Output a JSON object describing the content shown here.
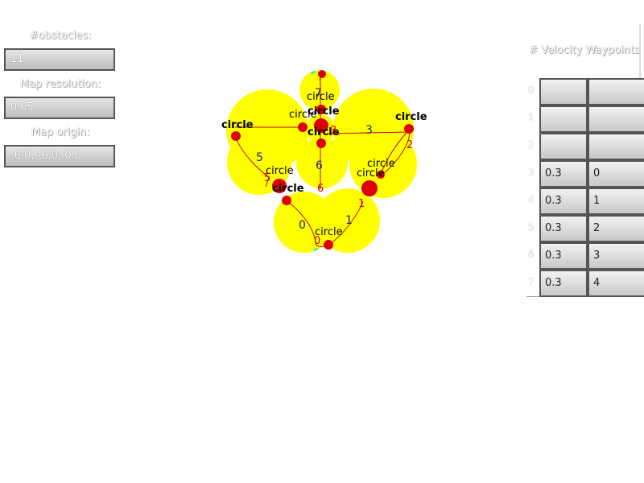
{
  "left_panel": {
    "obstacles": {
      "label": "#obstacles:",
      "value": "11"
    },
    "resolution": {
      "label": "Map resolution:",
      "value": "0.05"
    },
    "origin": {
      "label": "Map origin:",
      "value": "-6.0, -6.0, 0.0"
    }
  },
  "map": {
    "colors": {
      "obstacle_fill": "#ffff00",
      "node_fill": "#dd0000",
      "path_line": "#cc0000",
      "edge_label": "#1a237e",
      "waypoint_label": "#cc0000",
      "circle_label": "#000000",
      "accent_cyan": "#00e5ee"
    },
    "circle_label_text": "circle",
    "circle_labels": [
      "circle",
      "circle",
      "circle",
      "circle",
      "circle",
      "circle",
      "circle",
      "circle",
      "circle",
      "circle",
      "circle"
    ],
    "edge_labels": [
      "0",
      "1",
      "2",
      "3",
      "5",
      "6",
      "7"
    ],
    "waypoint_labels": [
      "0",
      "1",
      "2",
      "3",
      "5",
      "6",
      "7"
    ]
  },
  "table": {
    "header": "# Velocity Waypoints",
    "rows": [
      {
        "index": "0",
        "c1": "",
        "c2": ""
      },
      {
        "index": "1",
        "c1": "",
        "c2": ""
      },
      {
        "index": "2",
        "c1": "",
        "c2": ""
      },
      {
        "index": "3",
        "c1": "0.3",
        "c2": "0"
      },
      {
        "index": "4",
        "c1": "0.3",
        "c2": "1"
      },
      {
        "index": "5",
        "c1": "0.3",
        "c2": "2"
      },
      {
        "index": "6",
        "c1": "0.3",
        "c2": "3"
      },
      {
        "index": "7",
        "c1": "0.3",
        "c2": "4"
      }
    ]
  }
}
